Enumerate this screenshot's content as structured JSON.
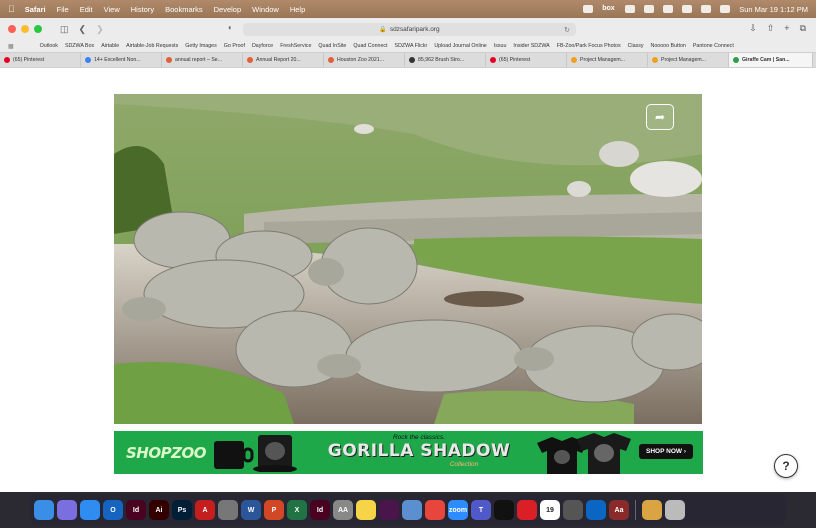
{
  "menubar": {
    "app_name": "Safari",
    "menus": [
      "File",
      "Edit",
      "View",
      "History",
      "Bookmarks",
      "Develop",
      "Window",
      "Help"
    ],
    "datetime": "Sun Mar 19  1:12 PM",
    "box_label": "box"
  },
  "toolbar": {
    "url": "sdzsafaripark.org"
  },
  "bookmarks": [
    "Outlook",
    "SDZWA Box",
    "Airtable",
    "Airtable-Job Requests",
    "Getty Images",
    "Go Proof",
    "Dayforce",
    "FreshService",
    "Quad InSite",
    "Quad Connect",
    "SDZWA Flickr",
    "Upload Journal Online",
    "Issuu",
    "Insider SDZWA",
    "FB-Zoo/Park Focus Photos",
    "Classy",
    "Nooooo Button",
    "Pantone Connect"
  ],
  "tabs": [
    {
      "label": "(65) Pinterest",
      "color": "#e60023"
    },
    {
      "label": "14+ Excellent Non...",
      "color": "#3b82f6"
    },
    {
      "label": "annual report – Se...",
      "color": "#e0603a"
    },
    {
      "label": "Annual Report 20...",
      "color": "#e0603a"
    },
    {
      "label": "Houston Zoo 2021...",
      "color": "#e0603a"
    },
    {
      "label": "85,962 Brush Stro...",
      "color": "#333333"
    },
    {
      "label": "(65) Pinterest",
      "color": "#e60023"
    },
    {
      "label": "Project Managem...",
      "color": "#f0a020"
    },
    {
      "label": "Project Managem...",
      "color": "#f0a020"
    },
    {
      "label": "Giraffe Cam | San...",
      "color": "#2e9e4a"
    }
  ],
  "banner": {
    "logo": "SHOPZOO",
    "tagline": "Rock the classics.",
    "headline": "GORILLA SHADOW",
    "subline": "Collection",
    "cta": "SHOP NOW ›"
  },
  "help": {
    "label": "?"
  },
  "share": {
    "icon": "share-icon"
  },
  "dock": {
    "apps": [
      {
        "name": "finder",
        "color": "#3a8ee6",
        "label": ""
      },
      {
        "name": "launchpad",
        "color": "#7a6ee0",
        "label": ""
      },
      {
        "name": "safari",
        "color": "#2f8cf0",
        "label": ""
      },
      {
        "name": "outlook",
        "color": "#1565c0",
        "label": "O"
      },
      {
        "name": "indesign",
        "color": "#49021f",
        "label": "Id"
      },
      {
        "name": "illustrator",
        "color": "#330000",
        "label": "Ai"
      },
      {
        "name": "photoshop",
        "color": "#001e36",
        "label": "Ps"
      },
      {
        "name": "acrobat",
        "color": "#c41e1e",
        "label": "A"
      },
      {
        "name": "system-settings",
        "color": "#777777",
        "label": ""
      },
      {
        "name": "word",
        "color": "#2b579a",
        "label": "W"
      },
      {
        "name": "powerpoint",
        "color": "#d24726",
        "label": "P"
      },
      {
        "name": "excel",
        "color": "#217346",
        "label": "X"
      },
      {
        "name": "indesign-2",
        "color": "#49021f",
        "label": "Id"
      },
      {
        "name": "font-book",
        "color": "#888888",
        "label": "AA"
      },
      {
        "name": "notes",
        "color": "#f5d547",
        "label": ""
      },
      {
        "name": "slack",
        "color": "#4a154b",
        "label": ""
      },
      {
        "name": "preview",
        "color": "#5b8fd0",
        "label": ""
      },
      {
        "name": "chrome",
        "color": "#e8453c",
        "label": ""
      },
      {
        "name": "zoom",
        "color": "#2d8cff",
        "label": "zoom"
      },
      {
        "name": "teams",
        "color": "#5059c9",
        "label": "T"
      },
      {
        "name": "inkscape",
        "color": "#111111",
        "label": ""
      },
      {
        "name": "creative-cloud",
        "color": "#da1f26",
        "label": ""
      },
      {
        "name": "calendar",
        "color": "#ffffff",
        "label": "19"
      },
      {
        "name": "quicktime",
        "color": "#555555",
        "label": ""
      },
      {
        "name": "onedrive",
        "color": "#0a66c2",
        "label": ""
      },
      {
        "name": "dictionary",
        "color": "#8b2a2a",
        "label": "Aa"
      },
      {
        "name": "downloads",
        "color": "#d9a441",
        "label": ""
      },
      {
        "name": "trash",
        "color": "#bbbbbb",
        "label": ""
      }
    ]
  }
}
